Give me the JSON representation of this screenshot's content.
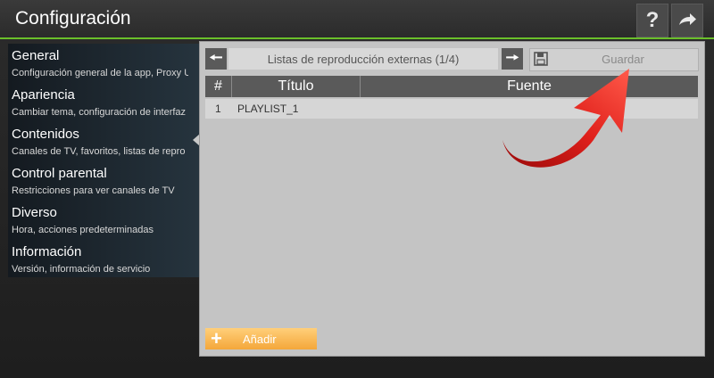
{
  "header": {
    "title": "Configuración",
    "help_icon": "question-mark-icon",
    "exit_icon": "arrow-right-icon",
    "accent_color": "#6abf2a"
  },
  "sidebar": {
    "items": [
      {
        "title": "General",
        "subtitle": "Configuración general de la app, Proxy U"
      },
      {
        "title": "Apariencia",
        "subtitle": "Cambiar tema, configuración de interfaz"
      },
      {
        "title": "Contenidos",
        "subtitle": "Canales de TV, favoritos, listas de repro"
      },
      {
        "title": "Control parental",
        "subtitle": "Restricciones para ver canales de TV"
      },
      {
        "title": "Diverso",
        "subtitle": "Hora, acciones predeterminadas"
      },
      {
        "title": "Información",
        "subtitle": "Versión, información de servicio"
      }
    ],
    "selected": "Contenidos"
  },
  "panel": {
    "list_title": "Listas de reproducción externas (1/4)",
    "prev_icon": "arrow-left-icon",
    "next_icon": "arrow-right-icon",
    "save_label": "Guardar",
    "save_icon": "floppy-disk-icon",
    "table": {
      "columns": [
        "#",
        "Título",
        "Fuente"
      ],
      "rows": [
        {
          "num": "1",
          "title": "PLAYLIST_1",
          "source": ""
        }
      ]
    },
    "add_label": "Añadir",
    "add_icon": "plus-icon",
    "add_color": "#f4a73a"
  },
  "annotation": {
    "icon": "curved-red-arrow-icon",
    "color": "#e0201b"
  }
}
